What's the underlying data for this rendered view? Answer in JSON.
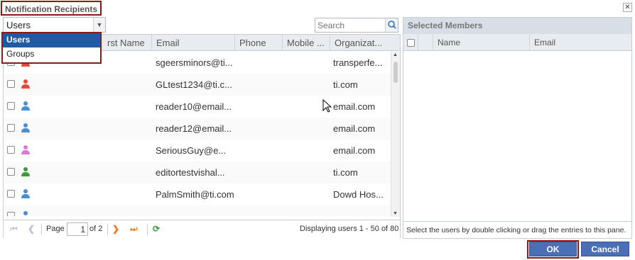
{
  "dialog": {
    "title": "Notification Recipients",
    "close_glyph": "✕"
  },
  "type_select": {
    "value": "Users",
    "options": [
      "Users",
      "Groups"
    ]
  },
  "search": {
    "placeholder": "Search"
  },
  "grid": {
    "columns": [
      "rst Name",
      "Email",
      "Phone",
      "Mobile ...",
      "Organizat..."
    ],
    "rows": [
      {
        "email": "sgeersminors@ti...",
        "org": "transperfe...",
        "icon_color": "#e8473c"
      },
      {
        "email": "GLtest1234@ti.c...",
        "org": "ti.com",
        "icon_color": "#e8473c"
      },
      {
        "email": "reader10@email...",
        "org": "email.com",
        "icon_color": "#4a90d0"
      },
      {
        "email": "reader12@email...",
        "org": "email.com",
        "icon_color": "#4a90d0"
      },
      {
        "email": "SeriousGuy@e...",
        "org": "email.com",
        "icon_color": "#d67cd6"
      },
      {
        "email": "editortestvishal...",
        "org": "ti.com",
        "icon_color": "#3f9a3f"
      },
      {
        "email": "PalmSmith@ti.com",
        "org": "Dowd Hos...",
        "icon_color": "#4a90d0"
      },
      {
        "email": "",
        "org": "",
        "icon_color": "#4a90d0"
      }
    ]
  },
  "pager": {
    "page_label": "Page",
    "page_value": "1",
    "of_label": "of 2",
    "display_text": "Displaying users 1 - 50 of 80"
  },
  "selected_panel": {
    "title": "Selected Members",
    "columns": [
      "Name",
      "Email"
    ],
    "footer_text": "Select the users by double clicking or drag the entries to this pane."
  },
  "buttons": {
    "ok": "OK",
    "cancel": "Cancel"
  }
}
